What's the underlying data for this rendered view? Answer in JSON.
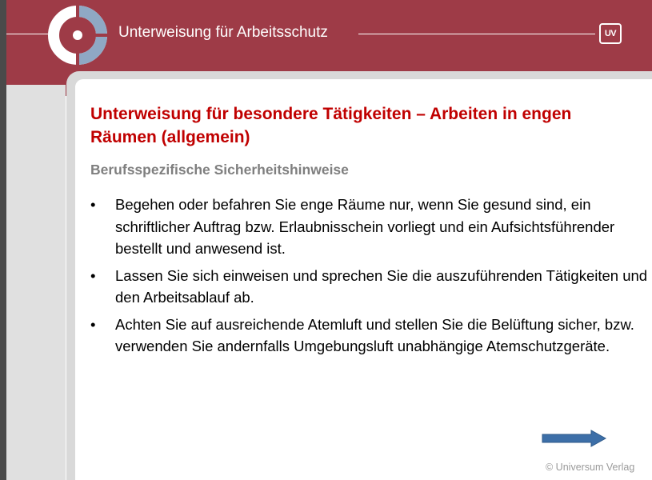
{
  "header": {
    "title": "Unterweisung für Arbeitsschutz",
    "badge": "UV",
    "background_color": "#9e3b47",
    "logo_icon": "circle-logo-icon"
  },
  "slide": {
    "title": "Unterweisung für besondere Tätigkeiten – Arbeiten in engen Räumen (allgemein)",
    "subtitle": "Berufsspezifische Sicherheitshinweise",
    "title_color": "#c00000",
    "subtitle_color": "#7f7f7f",
    "bullets": [
      {
        "marker": "•",
        "text": "Begehen oder befahren Sie enge Räume nur, wenn Sie gesund sind, ein schriftlicher Auftrag bzw. Erlaubnisschein vorliegt und ein Aufsichtsführender bestellt und anwesend ist."
      },
      {
        "marker": "•",
        "text": "Lassen Sie sich einweisen und sprechen Sie die auszuführenden Tätigkeiten und den Arbeitsablauf ab."
      },
      {
        "marker": "•",
        "text": "Achten Sie auf ausreichende Atemluft und stellen Sie die Belüftung sicher, bzw. verwenden Sie andernfalls Umgebungsluft unabhängige Atemschutzgeräte."
      }
    ],
    "next_icon": "arrow-right-icon",
    "copyright": "© Universum Verlag"
  }
}
